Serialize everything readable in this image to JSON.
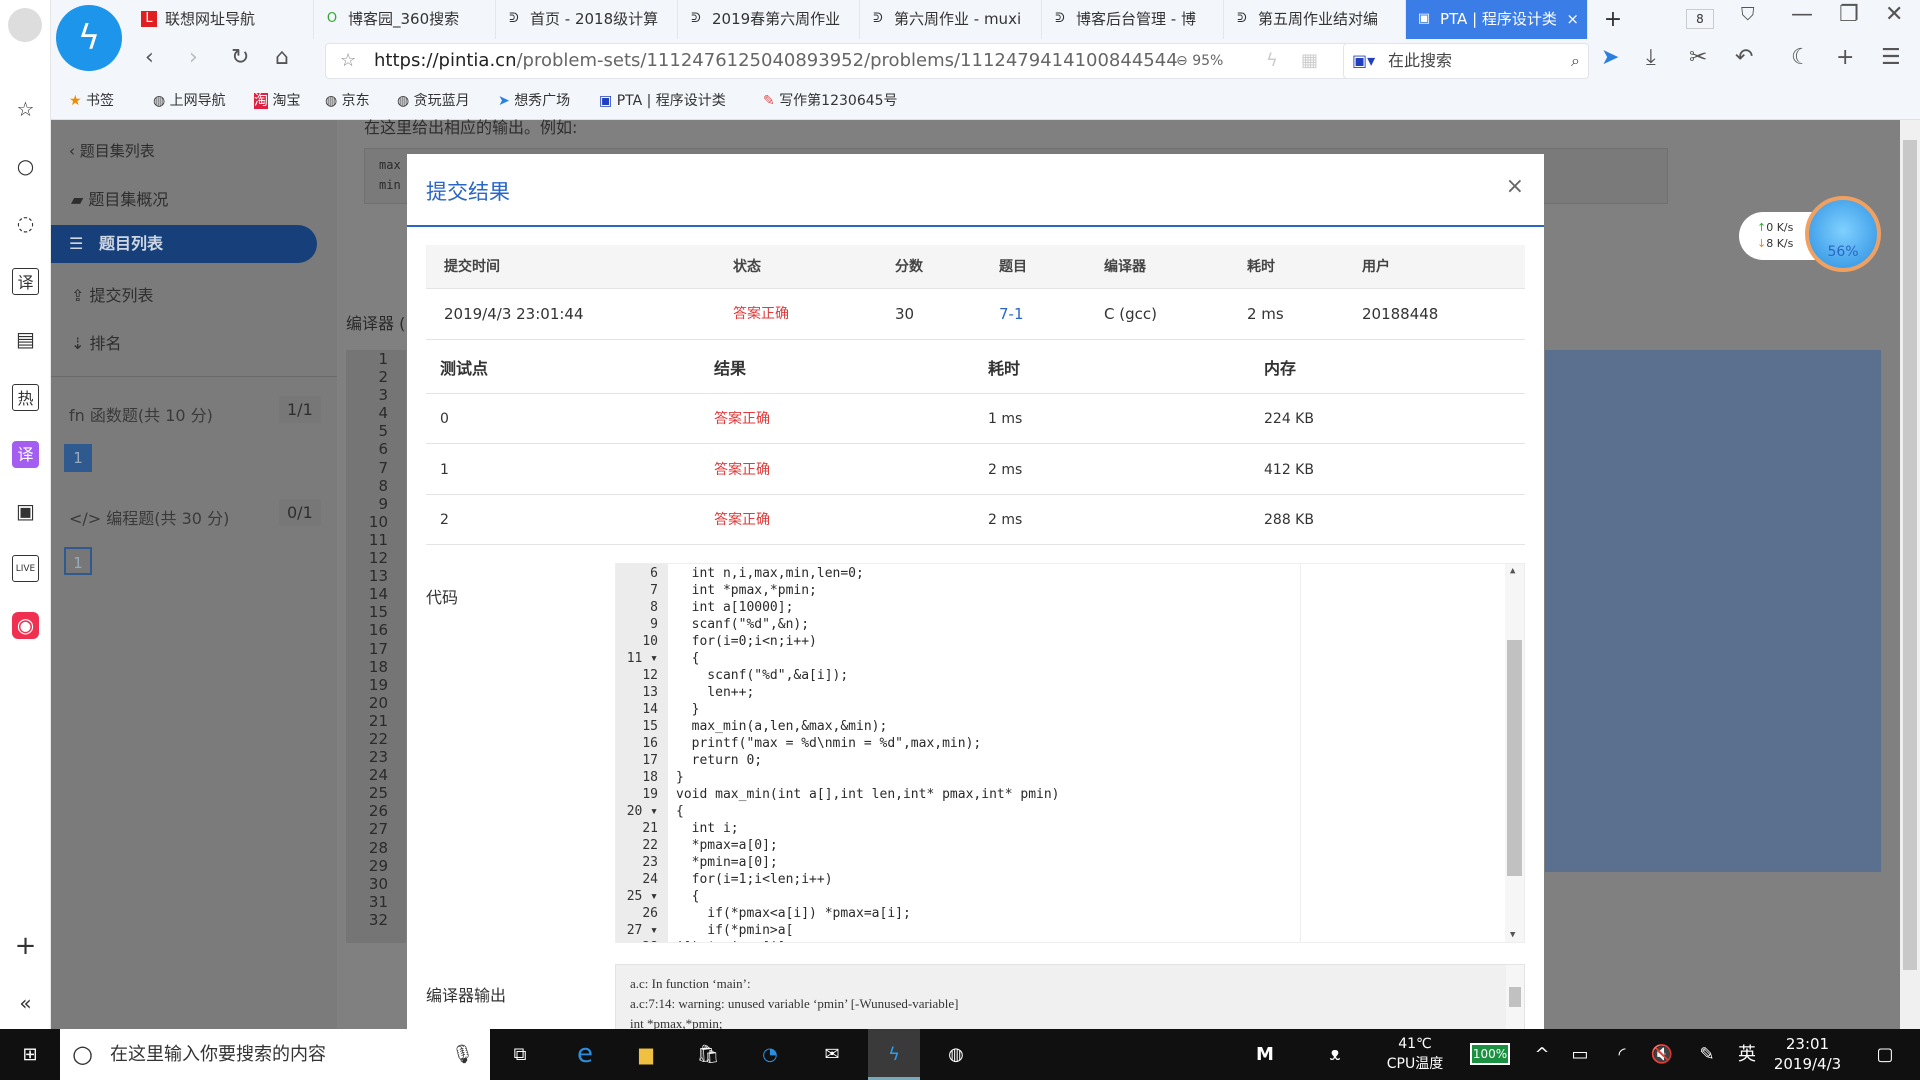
{
  "browser": {
    "tabs": [
      {
        "label": "联想网址导航",
        "icon": "L"
      },
      {
        "label": "博客园_360搜索",
        "icon": "O"
      },
      {
        "label": "首页 - 2018级计算",
        "icon": "cnblogs-icon"
      },
      {
        "label": "2019春第六周作业",
        "icon": "cnblogs-icon"
      },
      {
        "label": "第六周作业 - muxi",
        "icon": "cnblogs-icon"
      },
      {
        "label": "博客后台管理 - 博",
        "icon": "cnblogs-icon"
      },
      {
        "label": "第五周作业结对编",
        "icon": "cnblogs-icon"
      },
      {
        "label": "PTA | 程序设计类",
        "icon": "pta-icon"
      }
    ],
    "tab_count": "8",
    "url_host": "https://pintia.cn",
    "url_path": "/problem-sets/1112476125040893952/problems/1112479414100844544",
    "zoom": "95%",
    "search_placeholder": "在此搜索",
    "bookmarks": [
      "书签",
      "上网导航",
      "淘宝",
      "京东",
      "贪玩蓝月",
      "想秀广场",
      "PTA | 程序设计类",
      "写作第1230645号"
    ]
  },
  "sidebar": {
    "back": "题目集列表",
    "items": [
      "题目集概况",
      "题目列表",
      "提交列表",
      "排名"
    ],
    "groups": [
      {
        "label": "函数题(共 10 分)",
        "score": "1/1",
        "box": "1"
      },
      {
        "label": "编程题(共 30 分)",
        "score": "0/1",
        "box": "1"
      }
    ]
  },
  "background": {
    "hint": "在这里给出相应的输出。例如:",
    "sample": [
      "max",
      "min"
    ],
    "compiler_label": "编译器 ("
  },
  "modal": {
    "title": "提交结果",
    "close": "×",
    "headers": [
      "提交时间",
      "状态",
      "分数",
      "题目",
      "编译器",
      "耗时",
      "用户"
    ],
    "submission": {
      "time": "2019/4/3 23:01:44",
      "status": "答案正确",
      "score": "30",
      "problem": "7-1",
      "compiler": "C (gcc)",
      "elapsed": "2 ms",
      "user": "20188448"
    },
    "test_headers": [
      "测试点",
      "结果",
      "耗时",
      "内存"
    ],
    "tests": [
      {
        "id": "0",
        "result": "答案正确",
        "time": "1 ms",
        "memory": "224 KB"
      },
      {
        "id": "1",
        "result": "答案正确",
        "time": "2 ms",
        "memory": "412 KB"
      },
      {
        "id": "2",
        "result": "答案正确",
        "time": "2 ms",
        "memory": "288 KB"
      }
    ],
    "code_label": "代码",
    "code_start": 6,
    "code": [
      "  int n,i,max,min,len=0;",
      "  int *pmax,*pmin;",
      "  int a[10000];",
      "  scanf(\"%d\",&n);",
      "  for(i=0;i<n;i++)",
      "  {",
      "    scanf(\"%d\",&a[i]);",
      "    len++;",
      "  }",
      "  max_min(a,len,&max,&min);",
      "  printf(\"max = %d\\nmin = %d\",max,min);",
      "  return 0;",
      "}",
      "void max_min(int a[],int len,int* pmax,int* pmin)",
      "{",
      "  int i;",
      "  *pmax=a[0];",
      "  *pmin=a[0];",
      "  for(i=1;i<len;i++)",
      "  {",
      "    if(*pmax<a[i]) *pmax=a[i];",
      "    if(*pmin>a[",
      "i]) *pmin=a[i];"
    ],
    "fold_lines": [
      11,
      20,
      25,
      27
    ],
    "compiler_output_label": "编译器输出",
    "compiler_output": [
      "a.c: In function ‘main’:",
      "a.c:7:14: warning: unused variable ‘pmin’ [-Wunused-variable]",
      "   int *pmax,*pmin;"
    ]
  },
  "network": {
    "up": "0  K/s",
    "down": "8  K/s",
    "percent": "56%"
  },
  "taskbar": {
    "search_placeholder": "在这里输入你要搜索的内容",
    "temp": "41℃",
    "temp_label": "CPU温度",
    "battery": "100%",
    "ime": "英",
    "time": "23:01",
    "date": "2019/4/3"
  },
  "colors": {
    "accent": "#2b66c4",
    "success": "#e03a3a",
    "sidebar_selected": "#17407a"
  }
}
